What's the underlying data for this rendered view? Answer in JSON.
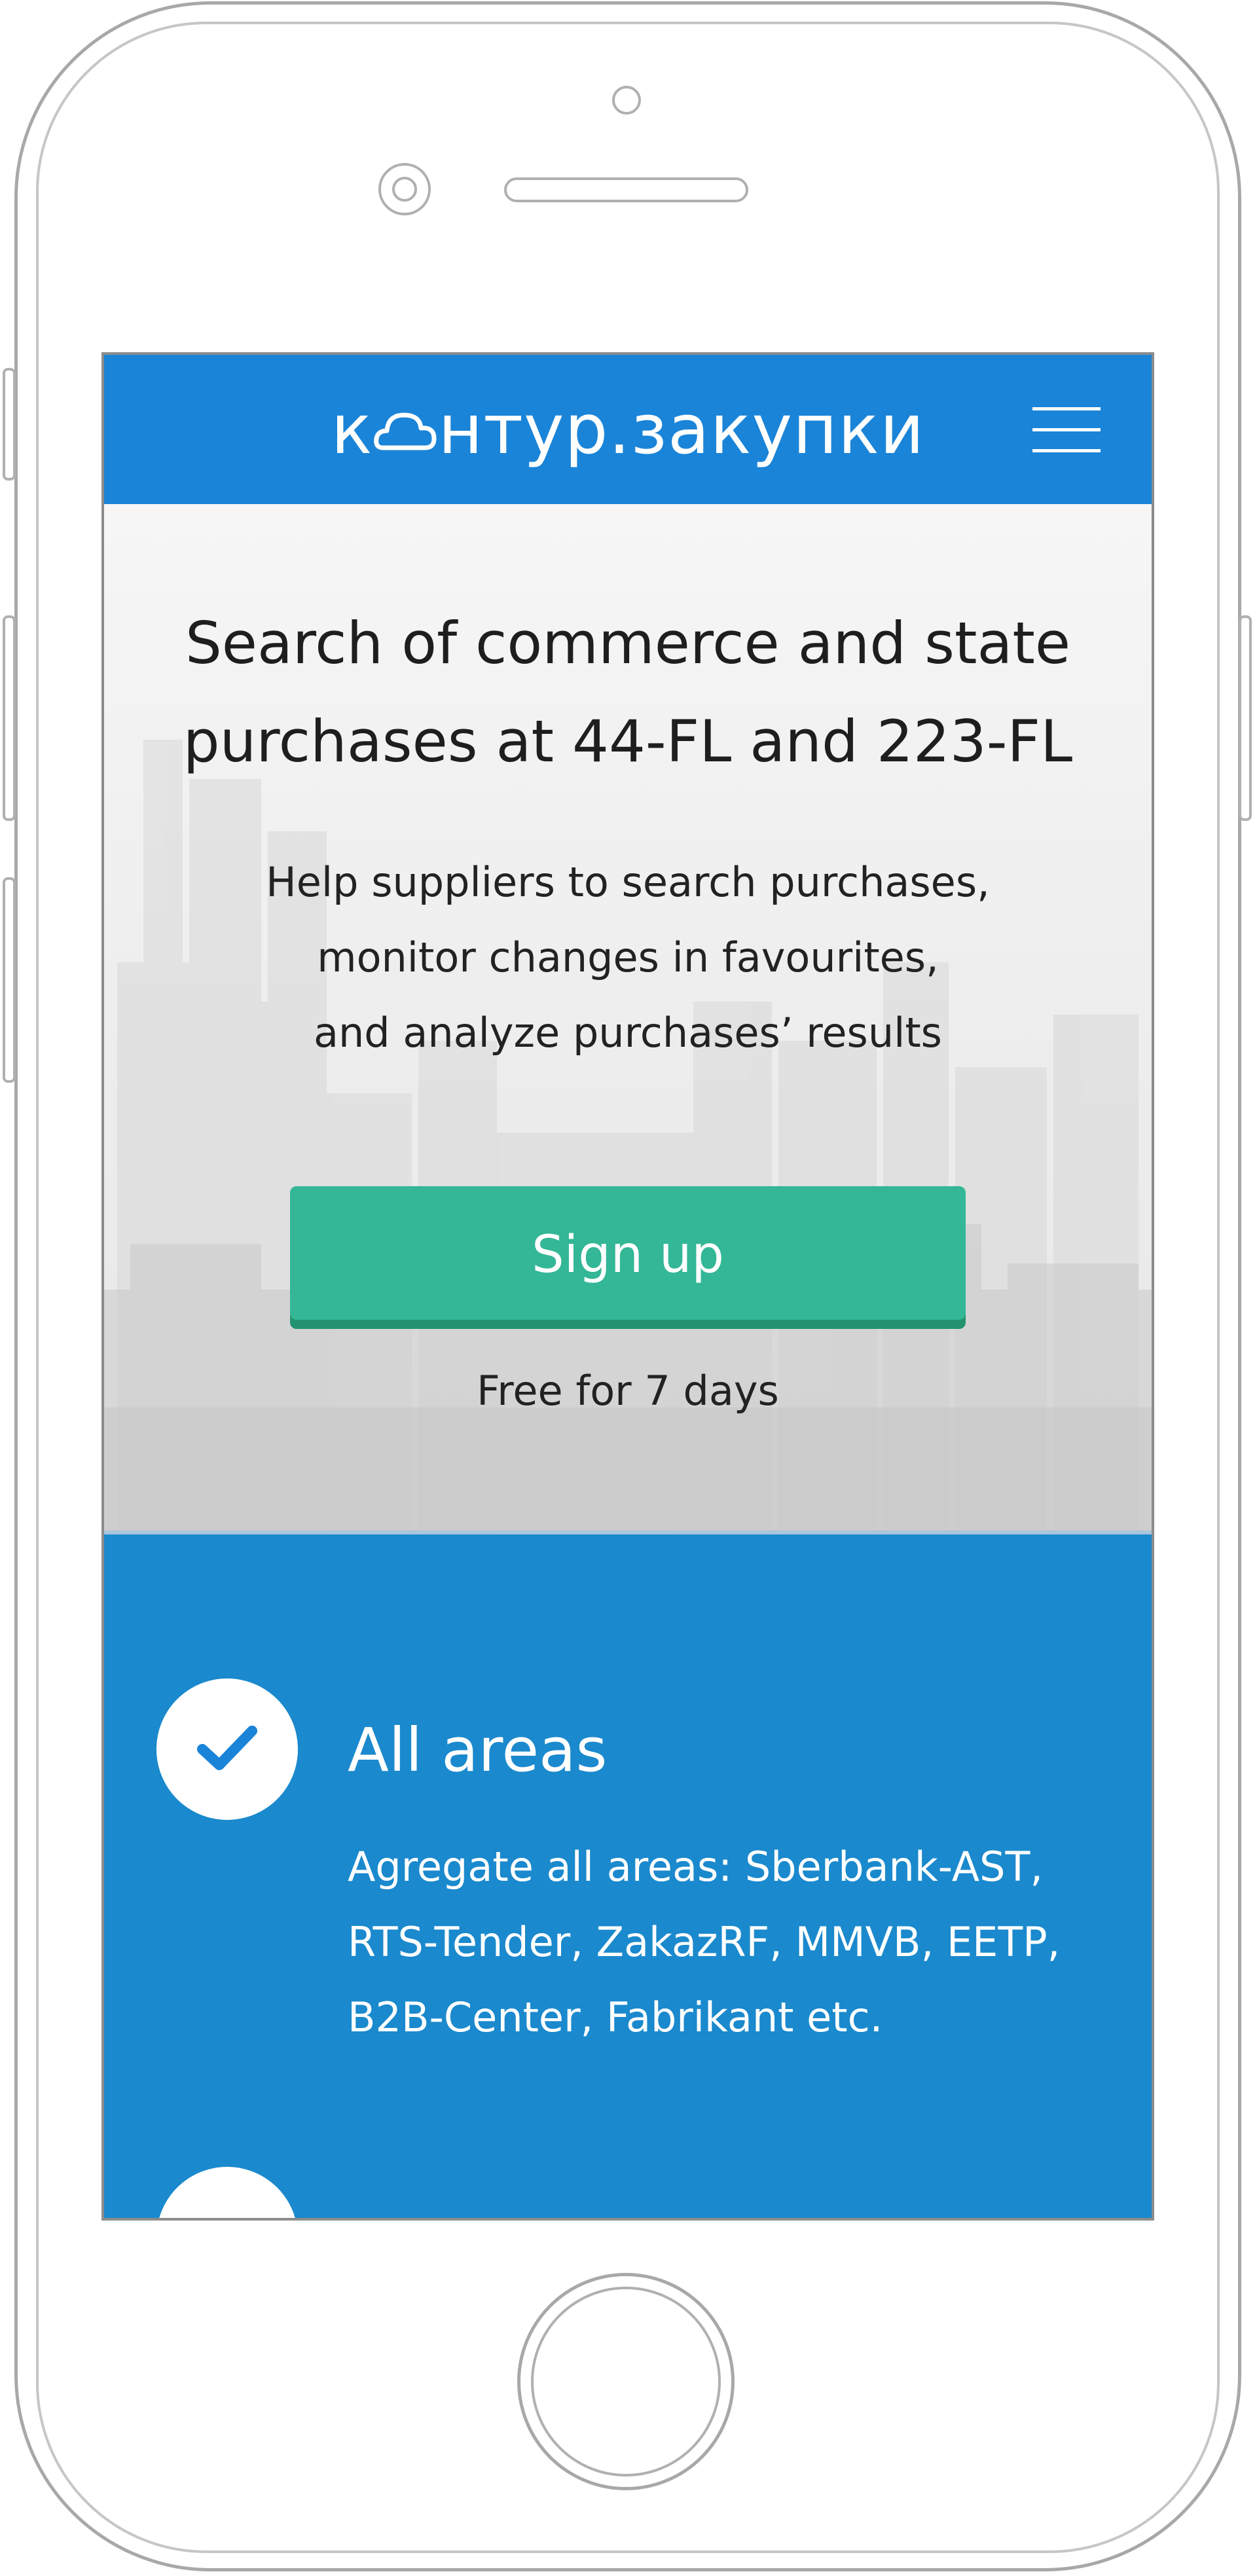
{
  "header": {
    "logo_before": "к",
    "logo_after": "нтур.закупки",
    "brand_color": "#1a84d8"
  },
  "hero": {
    "title_line1": "Search of commerce and state",
    "title_line2": "purchases at 44-FL and 223-FL",
    "subtitle_line1": "Help suppliers to search purchases,",
    "subtitle_line2": "monitor changes in favourites,",
    "subtitle_line3": "and analyze purchases’ results",
    "signup_label": "Sign up",
    "signup_color": "#33b796",
    "free_text": "Free for 7 days"
  },
  "features": {
    "background": "#1a89cd",
    "items": [
      {
        "icon": "check-icon",
        "title": "All areas",
        "desc_line1": "Agregate all areas: Sberbank-AST,",
        "desc_line2": "RTS-Tender, ZakazRF, MMVB, EETP,",
        "desc_line3": "B2B-Center, Fabrikant etc."
      }
    ]
  },
  "icons": {
    "menu": "hamburger-menu-icon",
    "logo_cloud": "cloud-icon"
  }
}
